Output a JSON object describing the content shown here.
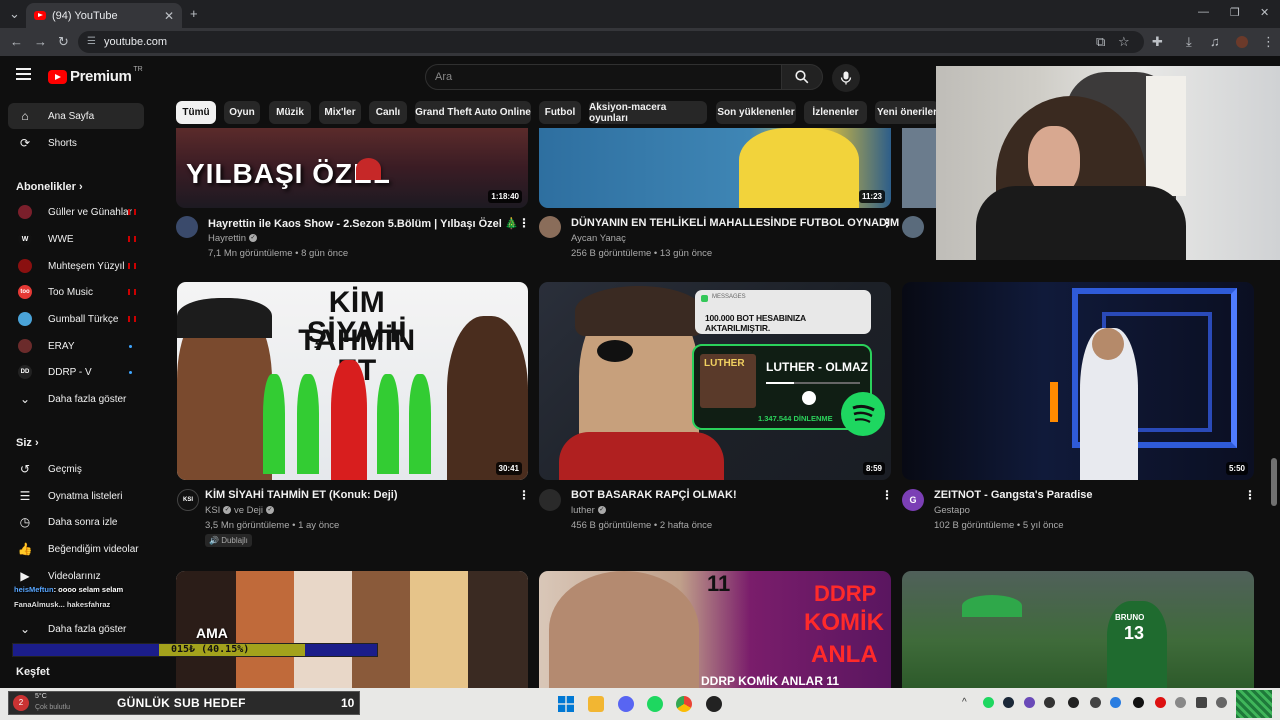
{
  "browser": {
    "tab_title": "(94) YouTube",
    "url": "youtube.com"
  },
  "youtube": {
    "logo_text": "Premium",
    "logo_region": "TR",
    "search_placeholder": "Ara"
  },
  "sidebar": {
    "main": [
      {
        "label": "Ana Sayfa",
        "icon": "home-icon",
        "active": true
      },
      {
        "label": "Shorts",
        "icon": "shorts-icon",
        "active": false
      }
    ],
    "subscriptions_header": "Abonelikler",
    "subscriptions": [
      {
        "label": "Güller ve Günahlar",
        "avatar_color": "#7a1f2b",
        "indicator": "live"
      },
      {
        "label": "WWE",
        "avatar_color": "#111111",
        "indicator": "live"
      },
      {
        "label": "Muhteşem Yüzyıl",
        "avatar_color": "#8a1010",
        "indicator": "live"
      },
      {
        "label": "Too Music",
        "avatar_color": "#e53935",
        "indicator": "live"
      },
      {
        "label": "Gumball Türkçe",
        "avatar_color": "#4aa3d8",
        "indicator": "live"
      },
      {
        "label": "ERAY",
        "avatar_color": "#6b2b2b",
        "indicator": "dot"
      },
      {
        "label": "DDRP - V",
        "avatar_color": "#222222",
        "indicator": "dot"
      }
    ],
    "show_more_1": "Daha fazla göster",
    "you_header": "Siz",
    "you_items": [
      {
        "label": "Geçmiş",
        "icon": "history-icon"
      },
      {
        "label": "Oynatma listeleri",
        "icon": "playlists-icon"
      },
      {
        "label": "Daha sonra izle",
        "icon": "watch-later-icon"
      },
      {
        "label": "Beğendiğim videolar",
        "icon": "liked-icon"
      },
      {
        "label": "Videolarınız",
        "icon": "your-videos-icon"
      }
    ],
    "show_more_2": "Daha fazla göster",
    "explore_header": "Keşfet"
  },
  "chips": [
    "Tümü",
    "Oyun",
    "Müzik",
    "Mix'ler",
    "Canlı",
    "Grand Theft Auto Online",
    "Futbol",
    "Aksiyon-macera oyunları",
    "Son yüklenenler",
    "İzlenenler",
    "Yeni öneriler"
  ],
  "videos_row1": [
    {
      "title": "Hayrettin ile Kaos Show - 2.Sezon 5.Bölüm | Yılbaşı Özel 🎄",
      "channel": "Hayrettin",
      "verified": true,
      "meta": "7,1 Mn görüntüleme • 8 gün önce",
      "duration": "1:18:40",
      "thumb_text": "YILBAŞI ÖZEL"
    },
    {
      "title": "DÜNYANIN EN TEHLİKELİ MAHALLESİNDE FUTBOL OYNADIM",
      "channel": "Aycan Yanaç",
      "verified": false,
      "meta": "256 B görüntüleme • 13 gün önce",
      "duration": "11:23"
    }
  ],
  "videos_row2": [
    {
      "title": "KİM SİYAHİ TAHMİN ET (Konuk: Deji)",
      "channel": "KSI",
      "channel_extra": "ve Deji",
      "verified": true,
      "meta": "3,5 Mn görüntüleme • 1 ay önce",
      "badge": "Dublajlı",
      "duration": "30:41",
      "thumb_line1": "KİM ŞİYAHİ",
      "thumb_line2": "TAHMİN ET",
      "avatar_text": "KSI"
    },
    {
      "title": "BOT BASARAK RAPÇİ OLMAK!",
      "channel": "luther",
      "verified": true,
      "meta": "456 B görüntüleme • 2 hafta önce",
      "duration": "8:59",
      "thumb_messages_label": "MESSAGES",
      "thumb_message": "100.000 BOT HESABINIZA AKTARILMIŞTIR.",
      "thumb_song": "LUTHER - OLMAZ",
      "thumb_album": "LUTHER",
      "thumb_plays": "1.347.544 DİNLENME"
    },
    {
      "title": "ZEITNOT - Gangsta's Paradise",
      "channel": "Gestapo",
      "verified": false,
      "meta": "102 B görüntüleme • 5 yıl önce",
      "duration": "5:50",
      "avatar_letter": "G"
    }
  ],
  "videos_row3": [
    {
      "thumb_text": "AMA"
    },
    {
      "thumb_text_1": "DDRP",
      "thumb_text_2": "KOMİK",
      "thumb_text_3": "ANLA",
      "thumb_caption": "DDRP KOMİK ANLAR 11",
      "thumb_number": "11"
    },
    {
      "thumb_jersey": "13",
      "thumb_name": "BRUNO"
    }
  ],
  "stream_overlay": {
    "chat_user": "heisMeftun",
    "chat_message": ": oooo selam selam",
    "chat_line2": "FanaAlmusk... hakesfahraz",
    "progress_text": "015₺ (40.15%)",
    "progress_fraction": 0.4015,
    "goal_label": "GÜNLÜK SUB HEDEF",
    "goal_value": "10",
    "weather_temp": "5°C",
    "weather_desc": "Çok bulutlu"
  },
  "colors": {
    "yt_red": "#ff0000",
    "bg": "#0f0f0f",
    "chip": "#272727",
    "progress_bg": "#1b1d8a",
    "progress_fill": "#a3a21c"
  }
}
